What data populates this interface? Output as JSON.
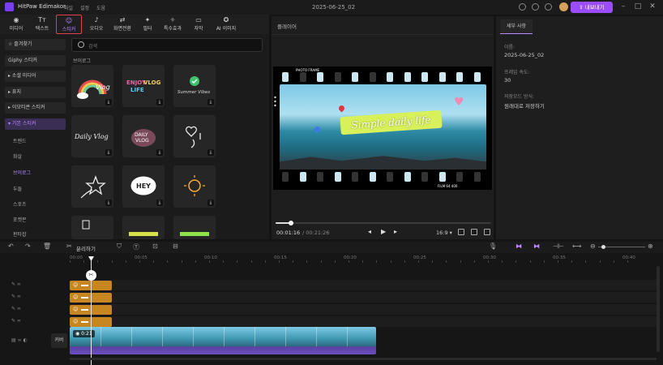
{
  "app": {
    "name": "HitPaw Edimakor",
    "menu": [
      "파일",
      "설정",
      "도움"
    ],
    "project": "2025-06-25_02",
    "export_label": "내보내기"
  },
  "colors": {
    "accent": "#9c4dfb",
    "clip_sticker": "#c7861f",
    "active_tab_border": "#e0404a"
  },
  "toolbar": {
    "items": [
      {
        "label": "미디어",
        "icon": "media-icon",
        "glyph": "◉"
      },
      {
        "label": "텍스트",
        "icon": "text-icon",
        "glyph": "Tт"
      },
      {
        "label": "스티커",
        "icon": "sticker-icon",
        "glyph": "☺"
      },
      {
        "label": "오디오",
        "icon": "audio-icon",
        "glyph": "♪"
      },
      {
        "label": "화면전환",
        "icon": "transition-icon",
        "glyph": "⇄"
      },
      {
        "label": "필터",
        "icon": "filter-icon",
        "glyph": "✦"
      },
      {
        "label": "특수효과",
        "icon": "effects-icon",
        "glyph": "✧"
      },
      {
        "label": "자막",
        "icon": "subtitle-icon",
        "glyph": "▭"
      },
      {
        "label": "AI 이미지",
        "icon": "ai-image-icon",
        "glyph": "✪"
      }
    ]
  },
  "categories": {
    "favorites": "즐겨찾기",
    "giphy": "Giphy 스티커",
    "social_media": "소셜 미디어",
    "emoji": "표지",
    "emoji_sticker": "이모티콘 스티커",
    "basic_sticker": "기본 스티커",
    "sub": [
      "트렌드",
      "화살",
      "브이로그",
      "두들",
      "스포츠",
      "포켓몬",
      "판타잡"
    ]
  },
  "search": {
    "placeholder": "검색"
  },
  "sticker_section": {
    "title": "브이로그"
  },
  "stickers": [
    {
      "name": "vlog-rainbow"
    },
    {
      "name": "vlog-enjoy"
    },
    {
      "name": "summer-vibes"
    },
    {
      "name": "daily-vlog-script"
    },
    {
      "name": "daily-vlog-blob"
    },
    {
      "name": "heart-doodle"
    },
    {
      "name": "stars-doodle"
    },
    {
      "name": "hey-bubble"
    },
    {
      "name": "sun-doodle"
    },
    {
      "name": "alarm-doodle"
    },
    {
      "name": "yellow-banner"
    },
    {
      "name": "green-banner"
    }
  ],
  "player": {
    "title": "플레이어",
    "photo_frame_label": "PHOTO FRAME",
    "tagline": "Simple daily life",
    "frame_bottom_label": "FILM 64 400",
    "current_time": "00:01:16",
    "total_time": "/ 00:21:26",
    "aspect_ratio": "16:9",
    "progress_fraction": 0.07
  },
  "details": {
    "tab": "세부 사항",
    "name_label": "이름:",
    "name_value": "2025-06-25_02",
    "framerate_label": "프레임 속도:",
    "framerate_value": "30",
    "save_label": "저장모드 방식:",
    "save_value": "원래대로 저장하기"
  },
  "timeline": {
    "split_label": "분리하기",
    "ruler": [
      "00:00",
      "00:05",
      "00:10",
      "00:15",
      "00:20",
      "00:25",
      "00:30",
      "00:35",
      "00:40"
    ],
    "cover_label": "커버",
    "video_clip_duration": "0:21"
  }
}
